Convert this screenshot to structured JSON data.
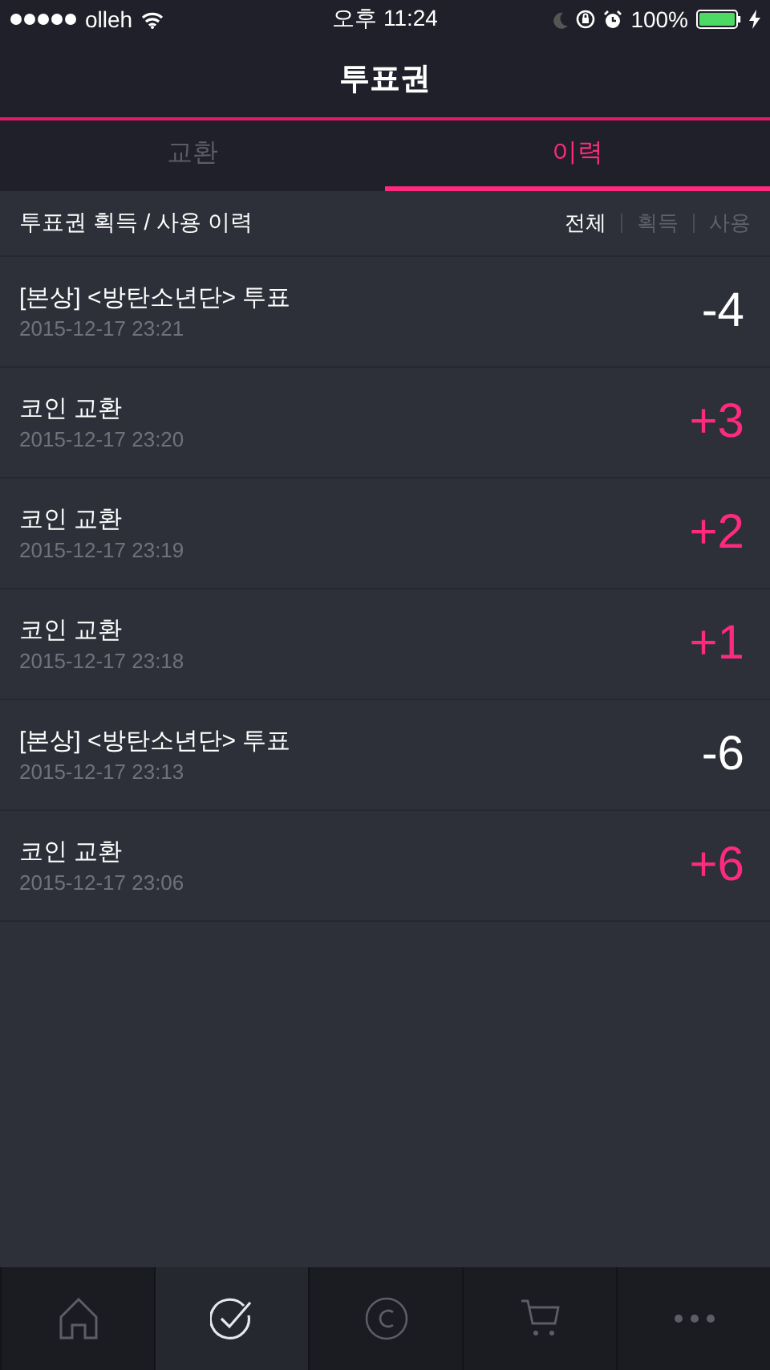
{
  "status_bar": {
    "carrier": "olleh",
    "time": "오후 11:24",
    "battery": "100%"
  },
  "header": {
    "title": "투표권"
  },
  "tabs": [
    {
      "label": "교환",
      "selected": false
    },
    {
      "label": "이력",
      "selected": true
    }
  ],
  "history": {
    "title": "투표권 획득 / 사용 이력",
    "filters": [
      {
        "label": "전체",
        "selected": true
      },
      {
        "label": "획득",
        "selected": false
      },
      {
        "label": "사용",
        "selected": false
      }
    ],
    "rows": [
      {
        "title": "[본상] <방탄소년단> 투표",
        "date": "2015-12-17 23:21",
        "amount": "-4",
        "kind": "use"
      },
      {
        "title": "코인 교환",
        "date": "2015-12-17 23:20",
        "amount": "+3",
        "kind": "gain"
      },
      {
        "title": "코인 교환",
        "date": "2015-12-17 23:19",
        "amount": "+2",
        "kind": "gain"
      },
      {
        "title": "코인 교환",
        "date": "2015-12-17 23:18",
        "amount": "+1",
        "kind": "gain"
      },
      {
        "title": "[본상] <방탄소년단> 투표",
        "date": "2015-12-17 23:13",
        "amount": "-6",
        "kind": "use"
      },
      {
        "title": "코인 교환",
        "date": "2015-12-17 23:06",
        "amount": "+6",
        "kind": "gain"
      }
    ]
  },
  "bottom_nav": [
    {
      "kind": "home",
      "selected": false
    },
    {
      "kind": "check",
      "selected": true
    },
    {
      "kind": "coin",
      "selected": false
    },
    {
      "kind": "cart",
      "selected": false
    },
    {
      "kind": "more",
      "selected": false
    }
  ]
}
